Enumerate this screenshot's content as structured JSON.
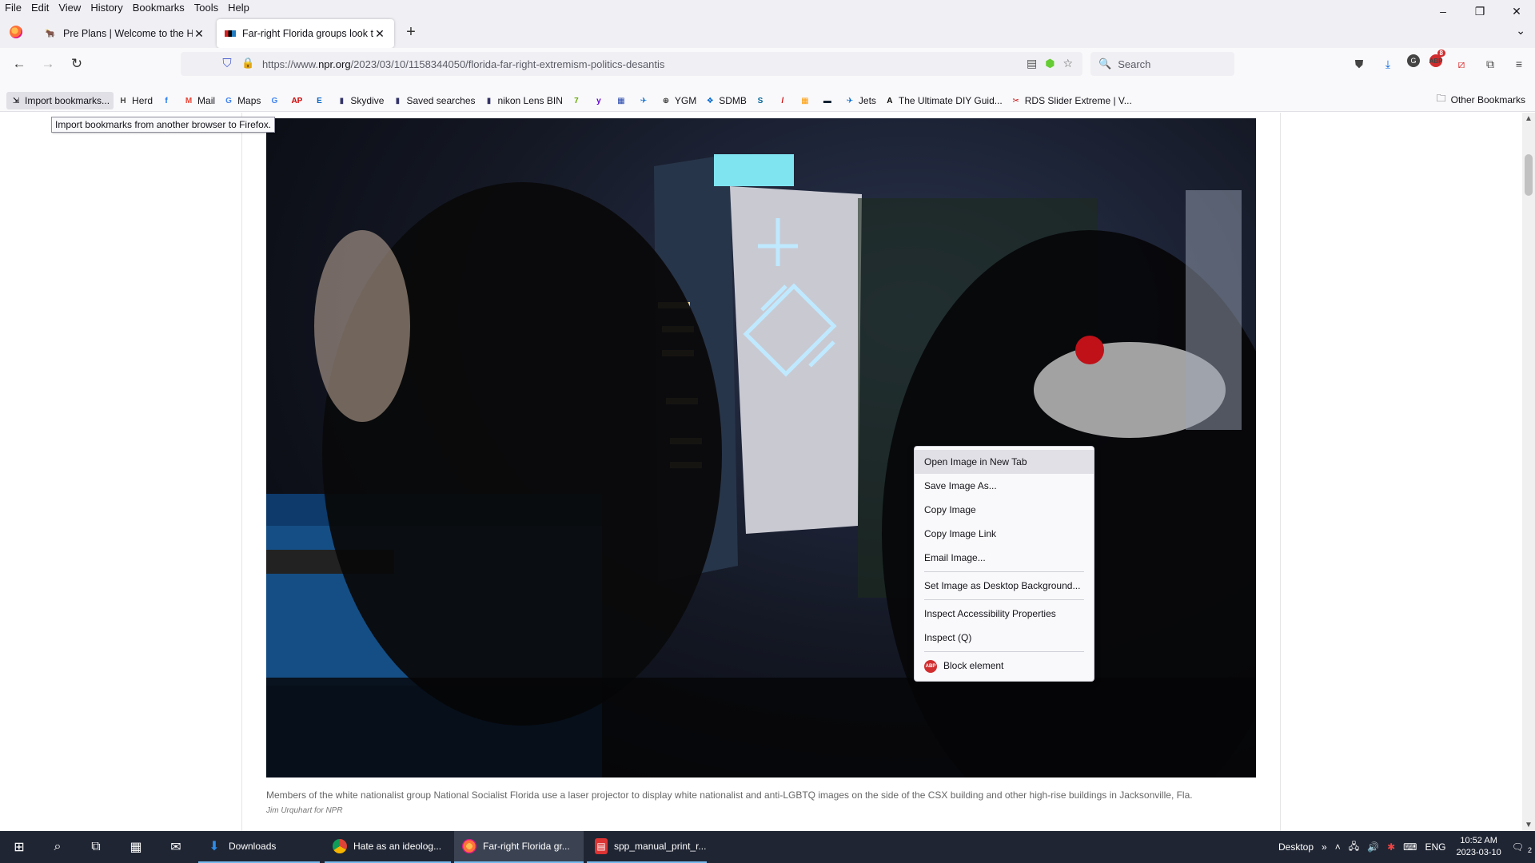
{
  "menubar": {
    "items": [
      "File",
      "Edit",
      "View",
      "History",
      "Bookmarks",
      "Tools",
      "Help"
    ]
  },
  "window_controls": {
    "minimize": "–",
    "restore": "❐",
    "close": "✕"
  },
  "tabs": [
    {
      "title": "Pre Plans | Welcome to the Herd",
      "active": false
    },
    {
      "title": "Far-right Florida groups look to",
      "active": true
    }
  ],
  "navbar": {
    "url_prefix": "https://www.",
    "url_domain": "npr.org",
    "url_path": "/2023/03/10/1158344050/florida-far-right-extremism-politics-desantis",
    "search_placeholder": "Search",
    "abp_count": "8"
  },
  "bookmarks": {
    "import_label": "Import bookmarks...",
    "items": [
      {
        "label": "Herd",
        "icon": "H",
        "color": "#444"
      },
      {
        "label": "",
        "icon": "f",
        "color": "#1877f2"
      },
      {
        "label": "Mail",
        "icon": "M",
        "color": "#ea4335"
      },
      {
        "label": "Maps",
        "icon": "G",
        "color": "#4285f4"
      },
      {
        "label": "",
        "icon": "G",
        "color": "#4285f4"
      },
      {
        "label": "",
        "icon": "AP",
        "color": "#c00"
      },
      {
        "label": "",
        "icon": "E",
        "color": "#0a66c2"
      },
      {
        "label": "Skydive",
        "icon": "▮",
        "color": "#336"
      },
      {
        "label": "Saved searches",
        "icon": "▮",
        "color": "#336"
      },
      {
        "label": "nikon Lens BIN",
        "icon": "▮",
        "color": "#336"
      },
      {
        "label": "",
        "icon": "7",
        "color": "#6a0"
      },
      {
        "label": "",
        "icon": "y",
        "color": "#6001d2"
      },
      {
        "label": "",
        "icon": "▦",
        "color": "#24a"
      },
      {
        "label": "",
        "icon": "✈",
        "color": "#06c"
      },
      {
        "label": "YGM",
        "icon": "⊕",
        "color": "#333"
      },
      {
        "label": "SDMB",
        "icon": "❖",
        "color": "#06c"
      },
      {
        "label": "",
        "icon": "S",
        "color": "#069"
      },
      {
        "label": "",
        "icon": "/",
        "color": "#c00"
      },
      {
        "label": "",
        "icon": "▦",
        "color": "#f90"
      },
      {
        "label": "",
        "icon": "▬",
        "color": "#123"
      },
      {
        "label": "Jets",
        "icon": "✈",
        "color": "#06c"
      },
      {
        "label": "The Ultimate DIY Guid...",
        "icon": "A",
        "color": "#000"
      },
      {
        "label": "RDS Slider Extreme | V...",
        "icon": "✂",
        "color": "#c00"
      }
    ],
    "other_label": "Other Bookmarks"
  },
  "tooltip": "Import bookmarks from another browser to Firefox.",
  "article": {
    "caption": "Members of the white nationalist group National Socialist Florida use a laser projector to display white nationalist and anti-LGBTQ images on the side of the CSX building and other high-rise buildings in Jacksonville, Fla.",
    "credit": "Jim Urquhart for NPR"
  },
  "context_menu": {
    "items": [
      {
        "label": "Open Image in New Tab",
        "hover": true
      },
      {
        "label": "Save Image As..."
      },
      {
        "label": "Copy Image"
      },
      {
        "label": "Copy Image Link"
      },
      {
        "label": "Email Image..."
      },
      {
        "label": "Set Image as Desktop Background..."
      },
      {
        "label": "Inspect Accessibility Properties"
      },
      {
        "label": "Inspect (Q)"
      },
      {
        "label": "Block element"
      }
    ]
  },
  "taskbar": {
    "apps": [
      {
        "label": "Downloads",
        "icon": "⬇",
        "color": "#2d8be8"
      },
      {
        "label": "Hate as an ideolog...",
        "icon": "◉",
        "color": "#e44"
      },
      {
        "label": "Far-right Florida gr...",
        "icon": "◉",
        "color": "#ff7139"
      },
      {
        "label": "spp_manual_print_r...",
        "icon": "▤",
        "color": "#d33"
      }
    ],
    "desktop_label": "Desktop",
    "lang": "ENG",
    "time": "10:52 AM",
    "date": "2023-03-10",
    "notifications": "2"
  },
  "colors": {
    "accent": "#0061e0",
    "taskbar_bg": "#1f2533",
    "abp_red": "#d12d2f"
  }
}
